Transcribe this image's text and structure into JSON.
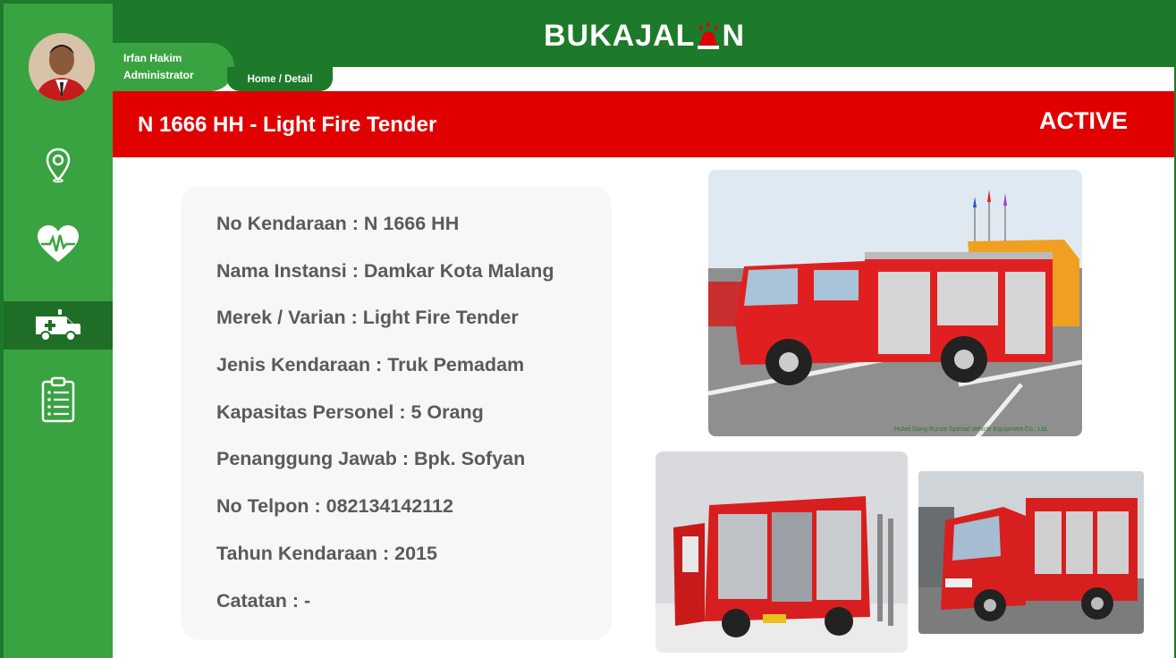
{
  "user": {
    "name": "Irfan Hakim",
    "role": "Administrator"
  },
  "app": {
    "logo_text_a": "BUKAJAL",
    "logo_text_b": "N"
  },
  "breadcrumb": "Home / Detail",
  "header": {
    "title": "N 1666 HH - Light Fire Tender",
    "status": "ACTIVE"
  },
  "sidebar": {
    "items": [
      {
        "icon": "location-pin-icon"
      },
      {
        "icon": "heart-pulse-icon"
      },
      {
        "icon": "ambulance-icon",
        "active": true
      },
      {
        "icon": "clipboard-list-icon"
      }
    ]
  },
  "details": [
    {
      "label": "No Kendaraan",
      "value": "N 1666 HH"
    },
    {
      "label": "Nama Instansi",
      "value": "Damkar Kota Malang"
    },
    {
      "label": "Merek / Varian",
      "value": "Light Fire Tender"
    },
    {
      "label": "Jenis Kendaraan",
      "value": "Truk Pemadam"
    },
    {
      "label": "Kapasitas Personel",
      "value": "5 Orang"
    },
    {
      "label": "Penanggung Jawab",
      "value": "Bpk. Sofyan"
    },
    {
      "label": "No Telpon",
      "value": "082134142112"
    },
    {
      "label": "Tahun Kendaraan",
      "value": "2015"
    },
    {
      "label": "Catatan",
      "value": "-"
    }
  ],
  "photos": {
    "main_watermark": "Hubei Dong Runze Special Vehicle Equipment Co., Ltd."
  },
  "colors": {
    "dark_green": "#1d7a2a",
    "green": "#3aa341",
    "red": "#e00000",
    "text": "#5a5a5a"
  }
}
